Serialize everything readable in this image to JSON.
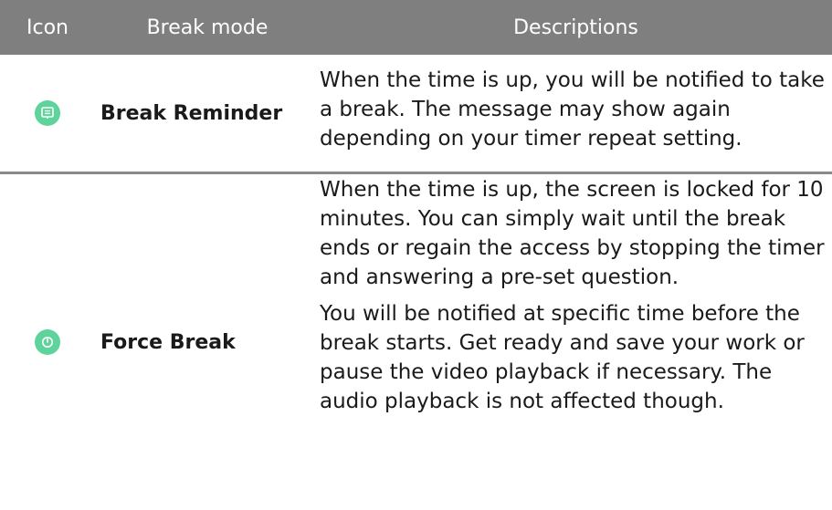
{
  "header": {
    "icon": "Icon",
    "mode": "Break mode",
    "desc": "Descriptions"
  },
  "rows": [
    {
      "icon": "message-icon",
      "mode": "Break Reminder",
      "desc": [
        "When the time is up, you will be notified to take a break. The message may show again depending on your timer repeat setting."
      ]
    },
    {
      "icon": "power-icon",
      "mode": "Force Break",
      "desc": [
        "When the time is up, the screen is locked for 10 minutes. You can simply wait until the break ends or regain the access by stopping the timer and answering a pre-set question.",
        "You will be notified at specific time before the break starts. Get ready and save your work or pause the video playback if necessary. The audio playback is not affected though."
      ]
    }
  ],
  "colors": {
    "header_bg": "#7f7f7f",
    "icon_bg": "#5fd39c"
  }
}
